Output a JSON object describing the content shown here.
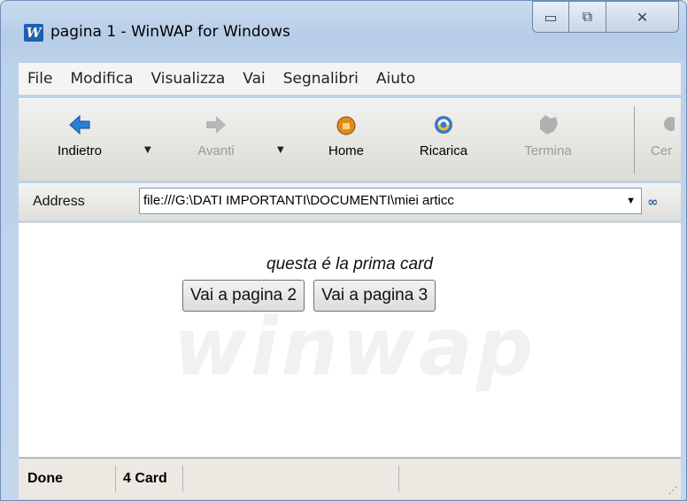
{
  "window": {
    "title": "pagina 1 - WinWAP for Windows",
    "app_icon": "W"
  },
  "window_controls": {
    "minimize": "▭",
    "maximize": "⧉",
    "close": "✕"
  },
  "menu": [
    "File",
    "Modifica",
    "Visualizza",
    "Vai",
    "Segnalibri",
    "Aiuto"
  ],
  "toolbar": {
    "back": "Indietro",
    "forward": "Avanti",
    "home": "Home",
    "reload": "Ricarica",
    "stop": "Termina",
    "search": "Cer"
  },
  "address": {
    "label": "Address",
    "value": "file:///G:\\DATI IMPORTANTI\\DOCUMENTI\\miei articc",
    "go": "∞"
  },
  "page": {
    "watermark": "winwap",
    "card_text": "questa é la prima card",
    "button1": "Vai a pagina 2",
    "button2": "Vai a pagina 3"
  },
  "status": {
    "state": "Done",
    "card": "4 Card"
  },
  "colors": {
    "frame": "#c3d6ec",
    "accent": "#1f5fb0"
  }
}
